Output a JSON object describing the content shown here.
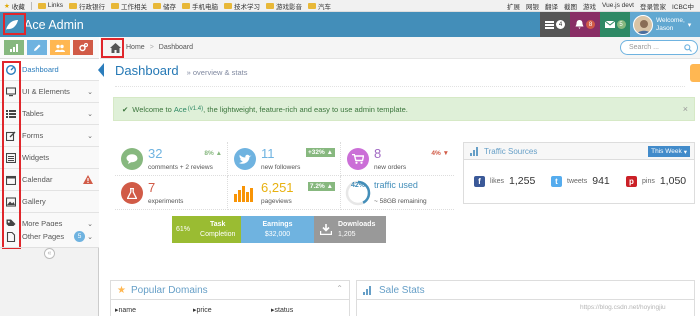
{
  "bookmarks": {
    "left": [
      "收藏",
      "Links",
      "行政银行",
      "工作相关",
      "储存",
      "手机电脑",
      "技术学习",
      "游戏影音",
      "汽车"
    ],
    "right": [
      "扩展",
      "网银",
      "翻译",
      "截图",
      "游戏",
      "Vue.js devt",
      "登录管家",
      "ICBC中"
    ]
  },
  "navbar": {
    "brand": "Ace Admin",
    "badges": [
      "4",
      "8",
      "5"
    ],
    "user_welcome": "Welcome,",
    "user_name": "Jason",
    "colors": {
      "navbar": "#438eb9",
      "tasks": "#555555",
      "notifications": "#892e65",
      "messages": "#2e8965"
    }
  },
  "sidebar": {
    "shortcuts": [
      {
        "icon": "signal-icon",
        "color": "#87b87f"
      },
      {
        "icon": "pencil-icon",
        "color": "#6fb3e0"
      },
      {
        "icon": "group-icon",
        "color": "#ffb752"
      },
      {
        "icon": "cogs-icon",
        "color": "#d15b47"
      }
    ],
    "items": [
      {
        "label": "Dashboard",
        "icon": "dashboard-icon"
      },
      {
        "label": "UI & Elements",
        "icon": "desktop-icon"
      },
      {
        "label": "Tables",
        "icon": "list-icon"
      },
      {
        "label": "Forms",
        "icon": "edit-icon"
      },
      {
        "label": "Widgets",
        "icon": "list-alt-icon"
      },
      {
        "label": "Calendar",
        "icon": "calendar-icon"
      },
      {
        "label": "Gallery",
        "icon": "picture-icon"
      },
      {
        "label": "More Pages",
        "icon": "tag-icon"
      },
      {
        "label": "Other Pages",
        "icon": "file-icon",
        "badge": "5"
      }
    ]
  },
  "breadcrumb": {
    "home": "Home",
    "current": "Dashboard"
  },
  "search": {
    "placeholder": "Search ..."
  },
  "page": {
    "title": "Dashboard",
    "subtitle": "» overview & stats"
  },
  "alert": {
    "prefix": "Welcome to",
    "brand": "Ace",
    "version": "(v1.4)",
    "rest": ", the lightweight, feature-rich and easy to use admin template.",
    "close": "×"
  },
  "infoboxes": [
    {
      "number": "32",
      "label": "comments + 2 reviews",
      "stat": "8%",
      "color": "#6fb3e0",
      "stat_color": "#87b87f",
      "icon": "comments-icon",
      "icon_color": "#87b87f"
    },
    {
      "number": "11",
      "label": "new followers",
      "stat": "+32%",
      "color": "#6fb3e0",
      "stat_color": "#87b87f",
      "icon": "twitter-icon",
      "icon_color": "#6fb3e0"
    },
    {
      "number": "8",
      "label": "new orders",
      "stat": "4%",
      "color": "#a069c3",
      "stat_color": "#d15b47",
      "icon": "shopping-cart-icon",
      "icon_color": "#cb6fd7"
    },
    {
      "number": "7",
      "label": "experiments",
      "color": "#d15b47",
      "icon": "beaker-icon",
      "icon_color": "#d15b47"
    },
    {
      "number": "6,251",
      "label": "pageviews",
      "stat": "7.2%",
      "color": "#e8b110",
      "stat_color": "#87b87f",
      "icon": "bar-chart-icon"
    },
    {
      "percent": "42%",
      "traffic_label": "traffic used",
      "remaining": "~ 58GB remaining",
      "traffic_used_fraction": 0.42
    }
  ],
  "tiles": [
    {
      "left": "61%",
      "top": "Task",
      "bottom": "Completion",
      "color": "#9abc32"
    },
    {
      "top": "Earnings",
      "bottom": "$32,000",
      "color": "#6fb3e0"
    },
    {
      "top": "Downloads",
      "bottom": "1,205",
      "color": "#999999"
    }
  ],
  "traffic": {
    "title": "Traffic Sources",
    "range": "This Week",
    "items": [
      {
        "label": "likes",
        "value": "1,255",
        "letter": "f",
        "color": "#3b5998"
      },
      {
        "label": "tweets",
        "value": "941",
        "letter": "t",
        "color": "#55acee"
      },
      {
        "label": "pins",
        "value": "1,050",
        "letter": "p",
        "color": "#cb2027"
      }
    ]
  },
  "popular": {
    "title": "Popular Domains",
    "columns": [
      "name",
      "price",
      "status"
    ]
  },
  "sale": {
    "title": "Sale Stats"
  },
  "watermark": "https://blog.csdn.net/hoyingjiu"
}
